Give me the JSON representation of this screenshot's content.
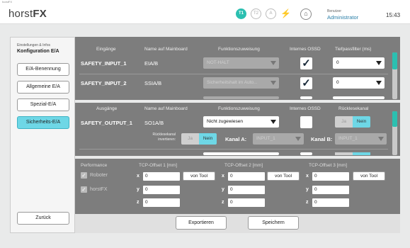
{
  "window": {
    "title": "horstFX"
  },
  "header": {
    "logo_light": "horst",
    "logo_bold": "FX",
    "modes": [
      "T1",
      "T2",
      "A"
    ],
    "user_label": "Benutzer",
    "user_name": "Administrator",
    "time": "15:43"
  },
  "sidebar": {
    "subtitle": "Einstellungen & Infos",
    "title": "Konfiguration E/A",
    "items": [
      {
        "label": "E/A-Benennung"
      },
      {
        "label": "Allgemeine E/A"
      },
      {
        "label": "Spezial-E/A"
      },
      {
        "label": "Sicherheits-E/A",
        "active": true
      }
    ],
    "back_label": "Zurück"
  },
  "inputs_section": {
    "headers": [
      "Eingänge",
      "Name auf Mainboard",
      "Funktionszuweisung",
      "Internes OSSD",
      "Tiefpassfilter (ms)"
    ],
    "rows": [
      {
        "name": "SAFETY_INPUT_1",
        "board": "EIA/B",
        "function": "NOT-HALT",
        "ossd": true,
        "filter": "0"
      },
      {
        "name": "SAFETY_INPUT_2",
        "board": "SSIA/B",
        "function": "Sicherheitshalt im Auto...",
        "ossd": true,
        "filter": "0"
      }
    ]
  },
  "outputs_section": {
    "headers": [
      "Ausgänge",
      "Name auf Mainboard",
      "Funktionszuweisung",
      "Internes OSSD",
      "Rücklesekanal"
    ],
    "rows": [
      {
        "name": "SAFETY_OUTPUT_1",
        "board": "SO1A/B",
        "function": "Nicht zugewiesen",
        "ossd": false,
        "readback_off": "Ja",
        "readback_on": "Nein"
      }
    ],
    "readback_inverted_label": "Rücklesekanal invertieren:",
    "inv_off": "Ja",
    "inv_on": "Nein",
    "channel_a_label": "Kanal A:",
    "channel_a_value": "INPUT_1",
    "channel_b_label": "Kanal B:",
    "channel_b_value": "INPUT_1"
  },
  "tcp_section": {
    "performance_label": "Performance",
    "checkboxes": [
      {
        "label": "Roboter",
        "checked": true
      },
      {
        "label": "horstFX",
        "checked": true
      }
    ],
    "offsets": [
      {
        "title": "TCP-Offset 1 [mm]",
        "x": "0",
        "y": "0",
        "z": "0",
        "button": "von Tool"
      },
      {
        "title": "TCP-Offset 2 [mm]",
        "x": "0",
        "y": "0",
        "z": "0",
        "button": "von Tool"
      },
      {
        "title": "TCP-Offset 3 [mm]",
        "x": "0",
        "y": "0",
        "z": "0",
        "button": "von Tool"
      }
    ],
    "axes": [
      "x",
      "y",
      "z"
    ]
  },
  "footer": {
    "export_label": "Exportieren",
    "save_label": "Speichern"
  }
}
